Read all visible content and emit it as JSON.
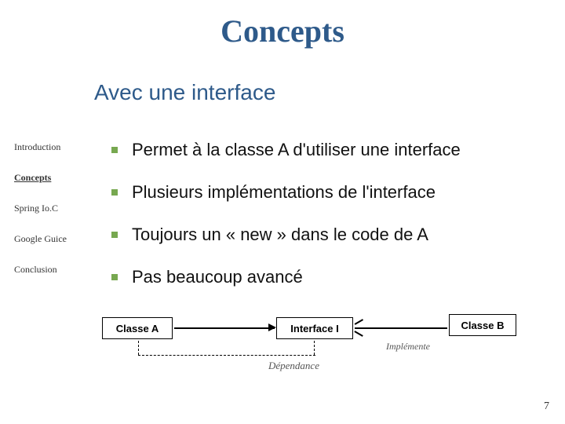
{
  "title": "Concepts",
  "subtitle": "Avec une interface",
  "sidebar": {
    "items": [
      {
        "label": "Introduction",
        "active": false
      },
      {
        "label": "Concepts",
        "active": true
      },
      {
        "label": "Spring Io.C",
        "active": false
      },
      {
        "label": "Google Guice",
        "active": false
      },
      {
        "label": "Conclusion",
        "active": false
      }
    ]
  },
  "bullets": [
    "Permet à la classe A d'utiliser une interface",
    "Plusieurs implémentations de l'interface",
    "Toujours un « new » dans le code de A",
    "Pas beaucoup avancé"
  ],
  "diagram": {
    "box_a": "Classe A",
    "box_i": "Interface I",
    "box_b": "Classe B",
    "impl_label": "Implémente",
    "dep_label": "Dépendance"
  },
  "page_number": "7"
}
